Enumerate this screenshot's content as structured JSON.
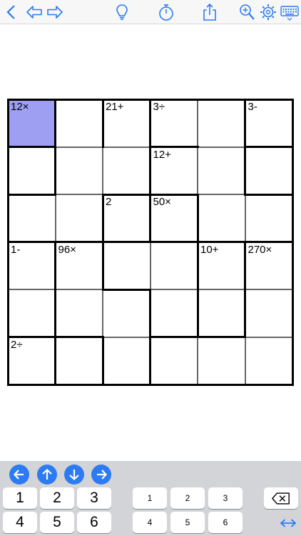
{
  "toolbar": {
    "icons": [
      "back-chevron-icon",
      "undo-arrow-icon",
      "redo-arrow-icon",
      "hint-lightbulb-icon",
      "timer-icon",
      "share-icon",
      "zoom-icon",
      "settings-gear-icon",
      "keyboard-icon"
    ]
  },
  "colors": {
    "accent": "#2d7bf2",
    "selected_cell": "#9e9ef2",
    "keypad_bg": "#d2d4d8"
  },
  "puzzle": {
    "size": 6,
    "selected_cell": [
      0,
      0
    ],
    "cage_labels": [
      {
        "row": 0,
        "col": 0,
        "text": "12×"
      },
      {
        "row": 0,
        "col": 2,
        "text": "21+"
      },
      {
        "row": 0,
        "col": 3,
        "text": "3÷"
      },
      {
        "row": 0,
        "col": 5,
        "text": "3-"
      },
      {
        "row": 1,
        "col": 3,
        "text": "12+"
      },
      {
        "row": 2,
        "col": 2,
        "text": "2"
      },
      {
        "row": 2,
        "col": 3,
        "text": "50×"
      },
      {
        "row": 3,
        "col": 0,
        "text": "1-"
      },
      {
        "row": 3,
        "col": 1,
        "text": "96×"
      },
      {
        "row": 3,
        "col": 4,
        "text": "10+"
      },
      {
        "row": 3,
        "col": 5,
        "text": "270×"
      },
      {
        "row": 5,
        "col": 0,
        "text": "2÷"
      }
    ]
  },
  "keypad": {
    "arrows": [
      "left-arrow-icon",
      "up-arrow-icon",
      "down-arrow-icon",
      "right-arrow-icon"
    ],
    "big_keys": [
      "1",
      "2",
      "3",
      "4",
      "5",
      "6"
    ],
    "small_keys": [
      "1",
      "2",
      "3",
      "4",
      "5",
      "6"
    ]
  }
}
